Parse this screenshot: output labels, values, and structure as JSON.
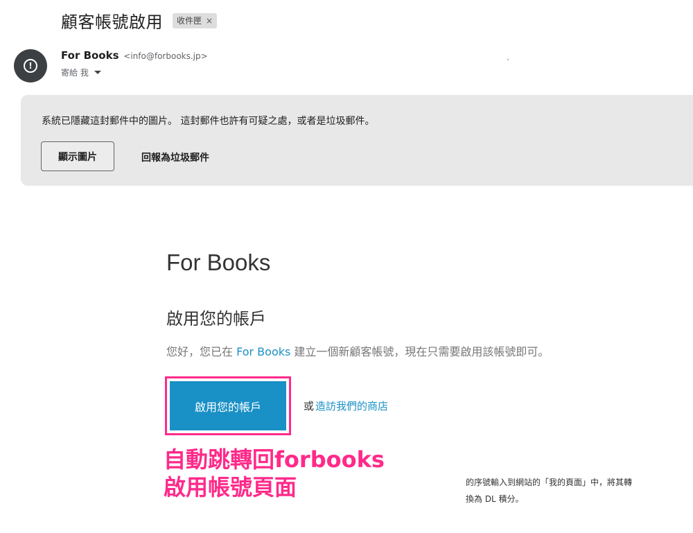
{
  "email": {
    "subject": "顧客帳號啟用",
    "label": "收件匣",
    "label_close": "×",
    "sender_name": "For Books",
    "sender_addr": "<info@forbooks.jp>",
    "to": "寄給 我"
  },
  "warning": {
    "text": "系統已隱藏這封郵件中的圖片。 這封郵件也許有可疑之處，或者是垃圾郵件。",
    "show_images": "顯示圖片",
    "report_spam": "回報為垃圾郵件"
  },
  "content": {
    "brand": "For Books",
    "heading": "啟用您的帳戶",
    "body_pre": "您好，您已在 ",
    "body_link": "For Books",
    "body_post": " 建立一個新顧客帳號，現在只需要啟用該帳號即可。",
    "cta_label": "啟用您的帳戶",
    "or_text": "或",
    "shop_link": "造訪我們的商店"
  },
  "annotation": {
    "line1": "自動跳轉回forbooks",
    "line2": "啟用帳號頁面"
  },
  "background_note": {
    "line1": "的序號輸入到網站的「我的頁面」中，將其轉",
    "line2": "換為 DL 積分。"
  },
  "colors": {
    "accent": "#1990c6",
    "highlight": "#ff2a8a",
    "banner": "#e8e8e8"
  }
}
